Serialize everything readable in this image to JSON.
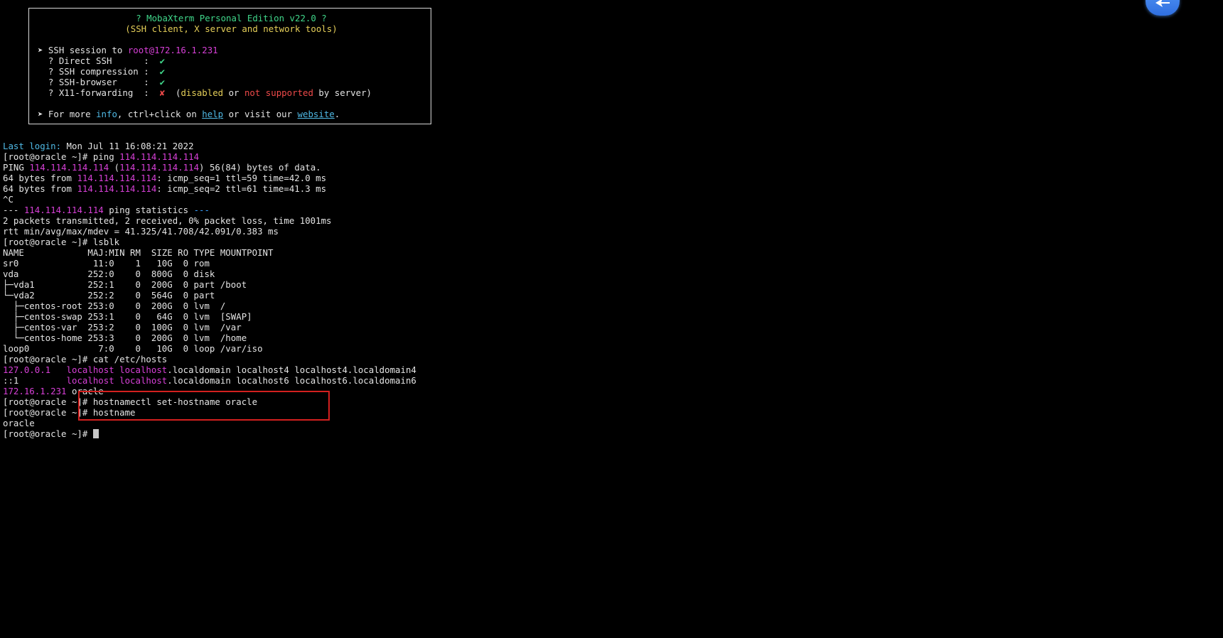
{
  "banner": {
    "title": "? MobaXterm Personal Edition v22.0 ?",
    "subtitle": "(SSH client, X server and network tools)",
    "session_prefix": "➤ SSH session to ",
    "session_host": "root@172.16.1.231",
    "features": [
      {
        "label": "  ? Direct SSH      :  ",
        "mark": "✔"
      },
      {
        "label": "  ? SSH compression :  ",
        "mark": "✔"
      },
      {
        "label": "  ? SSH-browser     :  ",
        "mark": "✔"
      }
    ],
    "x11_label": "  ? X11-forwarding  :  ",
    "x11_mark": "✘",
    "x11_paren_open": "  (",
    "x11_disabled": "disabled",
    "x11_or": " or ",
    "x11_not_supported": "not supported",
    "x11_by_server": " by server)",
    "more_prefix": "➤ For more ",
    "more_info": "info",
    "more_mid": ", ctrl+click on ",
    "more_help": "help",
    "more_or": " or visit our ",
    "more_website": "website",
    "more_end": "."
  },
  "terminal": {
    "last_login_label": "Last login:",
    "last_login_value": " Mon Jul 11 16:08:21 2022",
    "prompt": "[root@oracle ~]# ",
    "cmd_ping": "ping ",
    "ping_ip": "114.114.114.114",
    "ping_line_start": "PING ",
    "ping_line_mid": " (",
    "ping_line_end": ") 56(84) bytes of data.",
    "reply_prefix": "64 bytes from ",
    "reply1_rest": ": icmp_seq=1 ttl=59 time=42.0 ms",
    "reply2_rest": ": icmp_seq=2 ttl=61 time=41.3 ms",
    "interrupt": "^C",
    "stats_dash_open": "--- ",
    "stats_mid": " ping statistics ",
    "stats_dash_close": "---",
    "stats_line1": "2 packets transmitted, 2 received, 0% packet loss, time 1001ms",
    "stats_line2": "rtt min/avg/max/mdev = 41.325/41.708/42.091/0.383 ms",
    "cmd_lsblk": "lsblk",
    "lsblk_rows": [
      "NAME            MAJ:MIN RM  SIZE RO TYPE MOUNTPOINT",
      "sr0              11:0    1   10G  0 rom",
      "vda             252:0    0  800G  0 disk",
      "├─vda1          252:1    0  200G  0 part /boot",
      "└─vda2          252:2    0  564G  0 part",
      "  ├─centos-root 253:0    0  200G  0 lvm  /",
      "  ├─centos-swap 253:1    0   64G  0 lvm  [SWAP]",
      "  ├─centos-var  253:2    0  100G  0 lvm  /var",
      "  └─centos-home 253:3    0  200G  0 lvm  /home",
      "loop0             7:0    0   10G  0 loop /var/iso"
    ],
    "cmd_cat": "cat /etc/hosts",
    "hosts1_ip": "127.0.0.1",
    "hosts1_gap": "   ",
    "hosts1_lh": "localhost localhost",
    "hosts1_rest": ".localdomain localhost4 localhost4.localdomain4",
    "hosts2_ip": "::1",
    "hosts2_gap": "         ",
    "hosts2_lh": "localhost localhost",
    "hosts2_rest": ".localdomain localhost6 localhost6.localdomain6",
    "hosts3_ip": "172.16.1.231",
    "hosts3_name": " oracle",
    "cmd_sethost": "hostnamectl set-hostname oracle",
    "cmd_hostname": "hostname",
    "hostname_output": "oracle"
  },
  "colors": {
    "highlight_box": "#d3201f",
    "accent_blue": "#4f93f3"
  }
}
